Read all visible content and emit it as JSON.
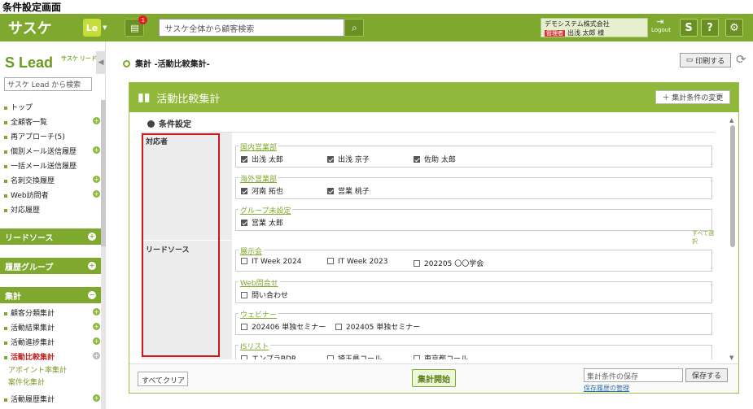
{
  "caption": "条件設定画面",
  "header": {
    "logo": "サスケ",
    "le": "Le",
    "le_caret": "▼",
    "notif_count": "1",
    "search_placeholder": "サスケ全体から顧客検索",
    "company": "デモシステム株式会社",
    "role": "管理者",
    "user": "出浅 太郎 様",
    "logout": "Logout",
    "btn_s": "S",
    "btn_help": "?",
    "btn_gear": "⚙"
  },
  "sidebar": {
    "logo": "Lead",
    "logo_sub": "サスケ リード",
    "collapse": "◀",
    "search_placeholder": "サスケ Lead から検索",
    "items": [
      {
        "label": "トップ",
        "plus": false
      },
      {
        "label": "全顧客一覧",
        "plus": true
      },
      {
        "label": "再アプローチ(5)",
        "plus": false
      },
      {
        "label": "個別メール送信履歴",
        "plus": true
      },
      {
        "label": "一括メール送信履歴",
        "plus": false
      },
      {
        "label": "名刺交換履歴",
        "plus": true
      },
      {
        "label": "Web訪問者",
        "plus": true
      },
      {
        "label": "対応履歴",
        "plus": false
      }
    ],
    "sections": [
      "リードソース",
      "履歴グループ",
      "集計"
    ],
    "agg_items": [
      "顧客分類集計",
      "活動結果集計",
      "活動進捗集計",
      "活動比較集計"
    ],
    "agg_subs": [
      "アポイント率集計",
      "案件化集計"
    ],
    "last_item": "活動履歴集計"
  },
  "breadcrumb": "集計 -活動比較集計-",
  "print_label": "印刷する",
  "panel": {
    "title": "活動比較集計",
    "change_btn": "＋ 集計条件の変更",
    "section": "条件設定",
    "label_staff": "対応者",
    "label_source": "リードソース",
    "select_all": "すべて選択",
    "groups": [
      {
        "name": "国内営業部",
        "items": [
          {
            "t": "出浅 太郎",
            "on": true
          },
          {
            "t": "出浅 京子",
            "on": true
          },
          {
            "t": "佐助 太郎",
            "on": true
          }
        ]
      },
      {
        "name": "海外営業部",
        "items": [
          {
            "t": "河南 拓也",
            "on": true
          },
          {
            "t": "営業 桃子",
            "on": true
          }
        ]
      },
      {
        "name": "グループ未設定",
        "items": [
          {
            "t": "営業 太郎",
            "on": true
          }
        ]
      },
      {
        "name": "展示会",
        "items": [
          {
            "t": "IT Week 2024",
            "on": false
          },
          {
            "t": "IT Week 2023",
            "on": false
          },
          {
            "t": "202205 〇〇学会",
            "on": false
          }
        ]
      },
      {
        "name": "Web問合せ",
        "items": [
          {
            "t": "問い合わせ",
            "on": false
          }
        ]
      },
      {
        "name": "ウェビナー",
        "items": [
          {
            "t": "202406 単独セミナー",
            "on": false
          },
          {
            "t": "202405 単独セミナー",
            "on": false
          }
        ]
      },
      {
        "name": "ISリスト",
        "items": [
          {
            "t": "エンプラBDR",
            "on": false
          },
          {
            "t": "埼玉県コール",
            "on": false
          },
          {
            "t": "東京都コール",
            "on": false
          }
        ]
      }
    ]
  },
  "footer": {
    "clear": "すべてクリア",
    "start": "集計開始",
    "save_placeholder": "集計条件の保存",
    "save_btn": "保存する",
    "history": "保存履歴の管理"
  }
}
